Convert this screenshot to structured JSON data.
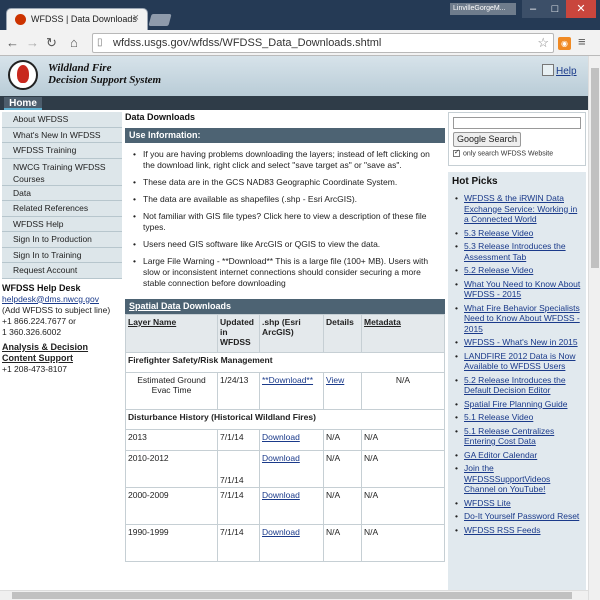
{
  "browser": {
    "tab_title": "WFDSS | Data Downloads",
    "tab_close": "×",
    "user_badge": "LinvilleGorgeM...",
    "url": "wfdss.usgs.gov/wfdss/WFDSS_Data_Downloads.shtml"
  },
  "header": {
    "site_title_1": "Wildland Fire",
    "site_title_2": "Decision Support System",
    "help": "Help"
  },
  "nav": {
    "home": "Home"
  },
  "sidebar": {
    "items": [
      {
        "label": "About WFDSS"
      },
      {
        "label": "What's New In WFDSS"
      },
      {
        "label": "WFDSS Training"
      },
      {
        "label": "NWCG Training WFDSS Courses"
      },
      {
        "label": "Data"
      },
      {
        "label": "Related References"
      },
      {
        "label": "WFDSS Help"
      },
      {
        "label": "Sign In to Production"
      },
      {
        "label": "Sign In to Training"
      },
      {
        "label": "Request Account"
      }
    ],
    "helpdesk_title": "WFDSS Help Desk",
    "helpdesk_email": "helpdesk@dms.nwcg.gov",
    "helpdesk_note": "(Add WFDSS to subject line)",
    "helpdesk_phone1": "+1 866.224.7677 or",
    "helpdesk_phone2": "1 360.326.6002",
    "analysis_title": "Analysis & Decision Content Support",
    "analysis_phone": "+1 208-473-8107"
  },
  "content": {
    "heading": "Data Downloads",
    "use_info_title": "Use Information:",
    "bullets": [
      "If you are having problems downloading the layers; instead of left clicking on the download link, right click and select \"save target as\" or \"save as\".",
      "These data are in the GCS NAD83 Geographic Coordinate System.",
      "The data are available as shapefiles (.shp - Esri ArcGIS).",
      "Not familiar with GIS file types? Click here to view a description of these file types.",
      "Users need GIS software like ArcGIS or QGIS to view the data.",
      "Large File Warning - **Download** This is a large file (100+ MB). Users with slow or inconsistent internet connections should consider securing a more stable connection before downloading"
    ],
    "spatial_title_link": "Spatial Data",
    "spatial_title_rest": " Downloads",
    "table": {
      "headers": [
        "Layer Name",
        "Updated in WFDSS",
        ".shp (Esri ArcGIS)",
        "Details",
        "Metadata"
      ],
      "group1": "Firefighter Safety/Risk Management",
      "row1": [
        "Estimated Ground Evac Time",
        "1/24/13",
        "**Download**",
        "View",
        "N/A"
      ],
      "group2": "Disturbance History (Historical Wildland Fires)",
      "rows": [
        [
          "2013",
          "7/1/14",
          "Download",
          "N/A",
          "N/A"
        ],
        [
          "2010-2012",
          "7/1/14",
          "Download",
          "N/A",
          "N/A"
        ],
        [
          "2000-2009",
          "7/1/14",
          "Download",
          "N/A",
          "N/A"
        ],
        [
          "1990-1999",
          "7/1/14",
          "Download",
          "N/A",
          "N/A"
        ]
      ]
    }
  },
  "search": {
    "button": "Google Search",
    "option": "only search WFDSS Website"
  },
  "hot_picks": {
    "title": "Hot Picks",
    "items": [
      "WFDSS & the iRWIN Data Exchange Service: Working in a Connected World",
      "5.3 Release Video",
      "5.3 Release Introduces the Assessment Tab",
      "5.2 Release Video",
      "What You Need to Know About WFDSS - 2015",
      "What Fire Behavior Specialists Need to Know About WFDSS - 2015",
      "WFDSS - What's New in 2015",
      "LANDFIRE 2012 Data is Now Available to WFDSS Users",
      "5.2 Release Introduces the Default Decision Editor",
      "Spatial Fire Planning Guide",
      "5.1 Release Video",
      "5.1 Release Centralizes Entering Cost Data",
      "GA Editor Calendar",
      "Join the WFDSSSupportVideos Channel on YouTube!",
      "WFDSS Lite",
      "Do-It Yourself Password Reset",
      "WFDSS RSS Feeds"
    ]
  }
}
